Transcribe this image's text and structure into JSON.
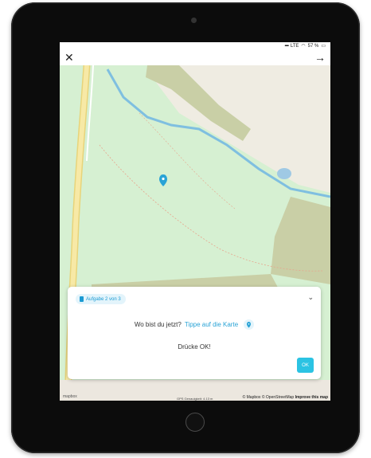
{
  "status_bar": {
    "network": "LTE",
    "battery": "57 %"
  },
  "app_bar": {
    "close_icon": "close-icon",
    "next_icon": "arrow-right-icon"
  },
  "task": {
    "badge": "Aufgabe 2 von 3",
    "question": "Wo bist du jetzt?",
    "question_link": "Tippe auf die Karte",
    "instruction": "Drücke OK!",
    "ok_label": "OK"
  },
  "map": {
    "attribution_mapbox": "© Mapbox",
    "attribution_osm": "© OpenStreetMap",
    "improve_link": "Improve this map",
    "logo": "mapbox",
    "scale_text": "GPS Genauigkeit: 4.13 m"
  },
  "colors": {
    "accent": "#2bc3e3",
    "link": "#29a3d6",
    "park": "#d6f0d2",
    "water": "#7fbfe0"
  }
}
